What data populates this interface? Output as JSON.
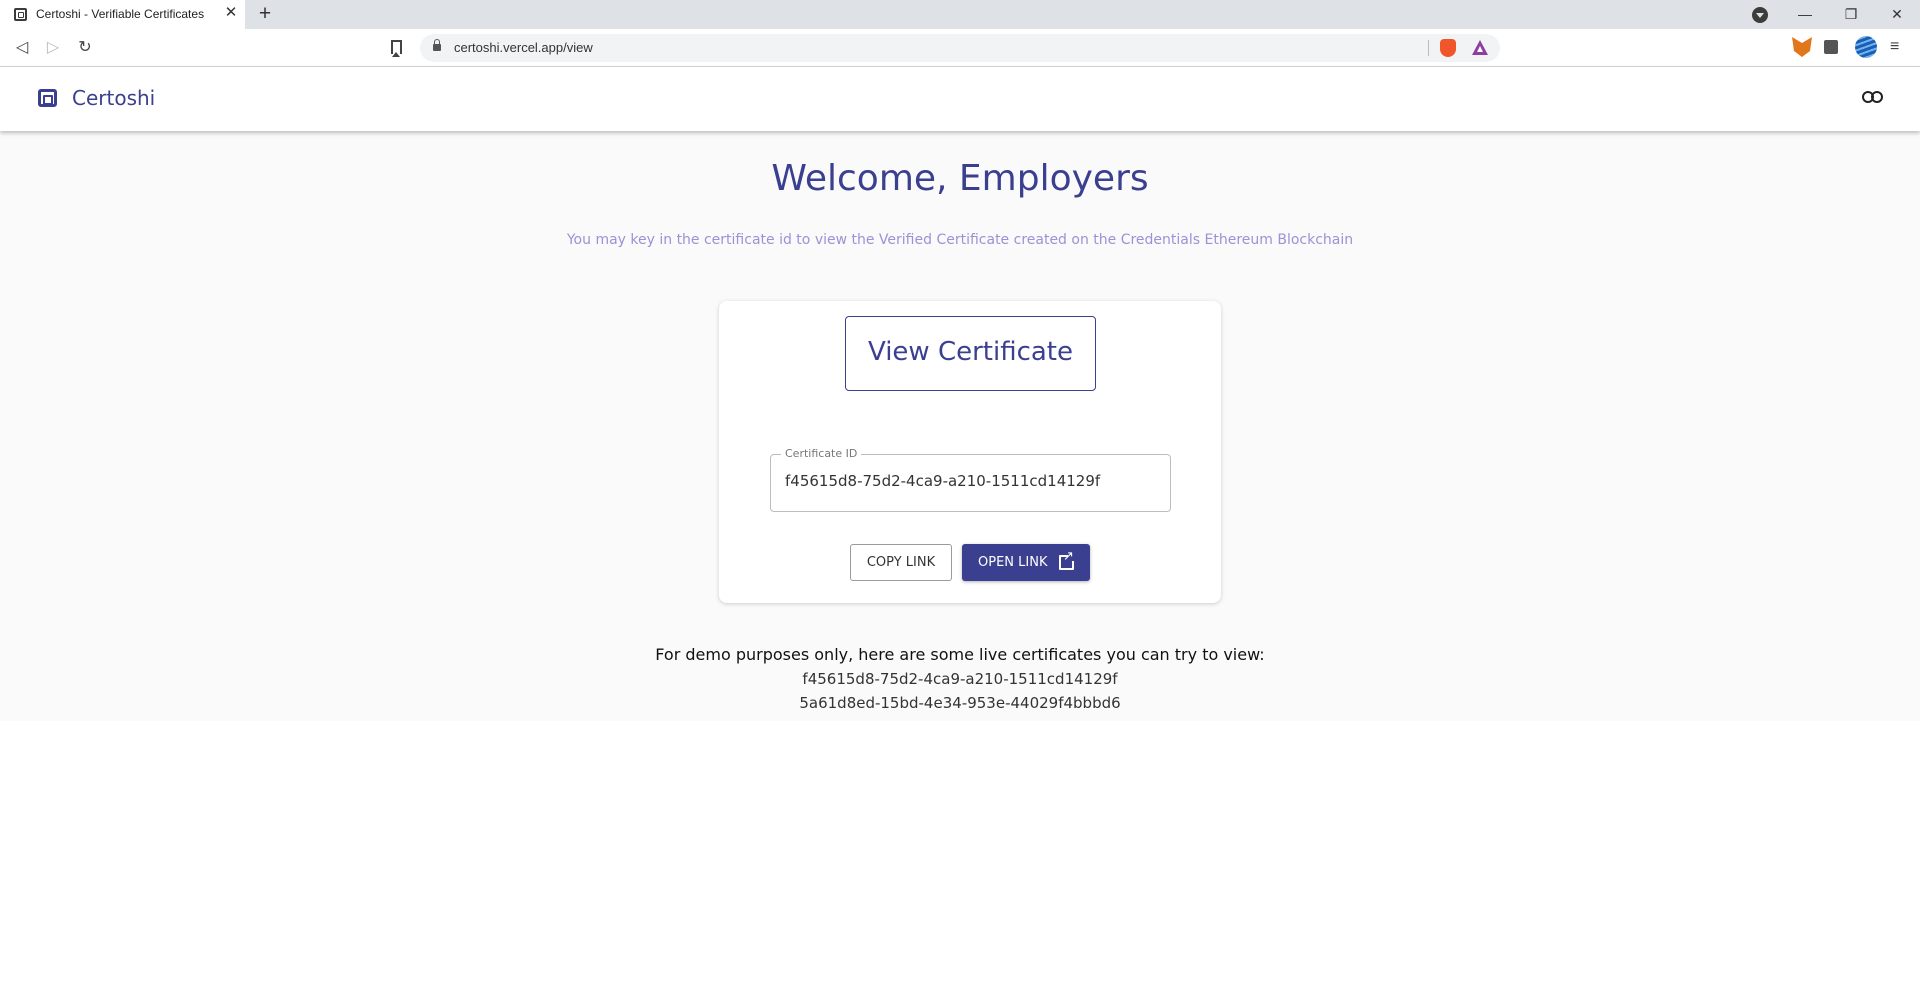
{
  "browser": {
    "tab_title": "Certoshi - Verifiable Certificates",
    "tab_close_glyph": "✕",
    "new_tab_glyph": "+",
    "url": "certoshi.vercel.app/view",
    "window_controls": {
      "minimize": "—",
      "restore": "❐",
      "close": "✕"
    },
    "nav": {
      "back": "◁",
      "forward": "▷",
      "reload": "↻"
    },
    "menu_glyph": "≡"
  },
  "app": {
    "brand_name": "Certoshi",
    "welcome_title": "Welcome, Employers",
    "subtitle": "You may key in the certificate id to view the Verified Certificate created on the Credentials Ethereum Blockchain",
    "card": {
      "title": "View Certificate",
      "field_label": "Certificate ID",
      "field_value": "f45615d8-75d2-4ca9-a210-1511cd14129f",
      "copy_button": "COPY LINK",
      "open_button": "OPEN LINK"
    },
    "demo": {
      "heading": "For demo purposes only, here are some live certificates you can try to view:",
      "ids": [
        "f45615d8-75d2-4ca9-a210-1511cd14129f",
        "5a61d8ed-15bd-4e34-953e-44029f4bbbd6"
      ]
    },
    "colors": {
      "primary": "#3b3f8f",
      "subtitle": "#9b92d6",
      "page_bg": "#fafafa"
    }
  }
}
